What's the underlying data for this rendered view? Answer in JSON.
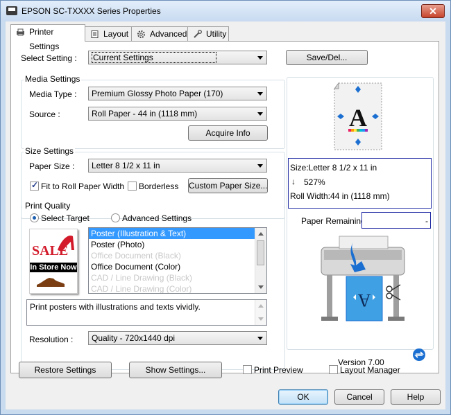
{
  "window": {
    "title": "EPSON SC-TXXXX Series Properties",
    "close": "✕"
  },
  "tabs": [
    {
      "label": "Printer Settings"
    },
    {
      "label": "Layout"
    },
    {
      "label": "Advanced"
    },
    {
      "label": "Utility"
    }
  ],
  "select_setting": {
    "label": "Select Setting :",
    "value": "Current Settings",
    "save_button": "Save/Del..."
  },
  "media_settings": {
    "title": "Media Settings",
    "media_type_label": "Media Type :",
    "media_type_value": "Premium Glossy Photo Paper (170)",
    "source_label": "Source :",
    "source_value": "Roll Paper - 44 in (1118 mm)",
    "acquire_button": "Acquire Info"
  },
  "size_settings": {
    "title": "Size Settings",
    "paper_size_label": "Paper Size :",
    "paper_size_value": "Letter 8 1/2 x 11 in",
    "fit_roll_label": "Fit to Roll Paper Width",
    "fit_roll_checked": true,
    "borderless_label": "Borderless",
    "borderless_checked": false,
    "custom_button": "Custom Paper Size..."
  },
  "print_quality": {
    "title": "Print Quality",
    "select_target_label": "Select Target",
    "advanced_label": "Advanced Settings",
    "targets": [
      {
        "label": "Poster (Illustration & Text)",
        "state": "selected"
      },
      {
        "label": "Poster (Photo)",
        "state": "normal"
      },
      {
        "label": "Office Document (Black)",
        "state": "disabled"
      },
      {
        "label": "Office Document (Color)",
        "state": "normal"
      },
      {
        "label": "CAD / Line Drawing (Black)",
        "state": "disabled"
      },
      {
        "label": "CAD / Line Drawing (Color)",
        "state": "disabled"
      }
    ],
    "sale_text": "SALE",
    "in_store_text": "In Store Now",
    "description": "Print posters with illustrations and texts vividly.",
    "resolution_label": "Resolution :",
    "resolution_value": "Quality - 720x1440 dpi"
  },
  "preview": {
    "size_line": "Size:Letter 8 1/2 x 11 in",
    "scale_arrow": "↓",
    "scale_value": "527%",
    "roll_width_line": "Roll Width:44 in (1118 mm)",
    "paper_remaining_label": "Paper Remaining:",
    "paper_remaining_value": "-",
    "version": "Version 7.00",
    "preview_letter": "A",
    "printer_letter": "A"
  },
  "bottom": {
    "restore_button": "Restore Settings",
    "show_button": "Show Settings...",
    "print_preview_label": "Print Preview",
    "layout_manager_label": "Layout Manager"
  },
  "footer": {
    "ok": "OK",
    "cancel": "Cancel",
    "help": "Help"
  }
}
